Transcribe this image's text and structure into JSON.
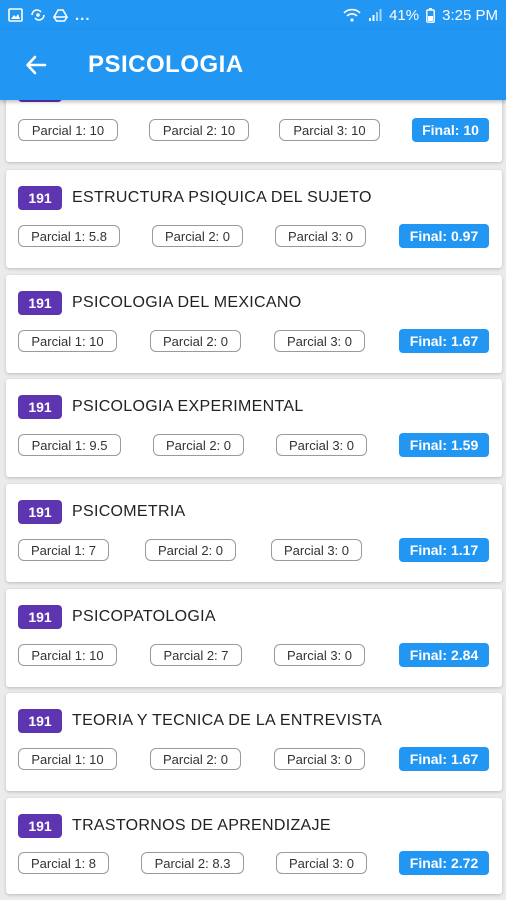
{
  "status_bar": {
    "battery": "41%",
    "time": "3:25 PM",
    "overflow": "..."
  },
  "header": {
    "title": "PSICOLOGIA",
    "back_icon": "arrow-left-icon"
  },
  "colors": {
    "primary": "#2196f3",
    "tag": "#5e35b1"
  },
  "subjects": [
    {
      "code": "",
      "name": "",
      "p1": "Parcial 1: 10",
      "p2": "Parcial 2: 10",
      "p3": "Parcial 3: 10",
      "final": "Final: 10"
    },
    {
      "code": "191",
      "name": "ESTRUCTURA PSIQUICA DEL SUJETO",
      "p1": "Parcial 1: 5.8",
      "p2": "Parcial 2: 0",
      "p3": "Parcial 3: 0",
      "final": "Final: 0.97"
    },
    {
      "code": "191",
      "name": "PSICOLOGIA DEL MEXICANO",
      "p1": "Parcial 1: 10",
      "p2": "Parcial 2: 0",
      "p3": "Parcial 3: 0",
      "final": "Final: 1.67"
    },
    {
      "code": "191",
      "name": "PSICOLOGIA EXPERIMENTAL",
      "p1": "Parcial 1: 9.5",
      "p2": "Parcial 2: 0",
      "p3": "Parcial 3: 0",
      "final": "Final: 1.59"
    },
    {
      "code": "191",
      "name": "PSICOMETRIA",
      "p1": "Parcial 1: 7",
      "p2": "Parcial 2: 0",
      "p3": "Parcial 3: 0",
      "final": "Final: 1.17"
    },
    {
      "code": "191",
      "name": "PSICOPATOLOGIA",
      "p1": "Parcial 1: 10",
      "p2": "Parcial 2: 7",
      "p3": "Parcial 3: 0",
      "final": "Final: 2.84"
    },
    {
      "code": "191",
      "name": "TEORIA Y TECNICA DE LA ENTREVISTA",
      "p1": "Parcial 1: 10",
      "p2": "Parcial 2: 0",
      "p3": "Parcial 3: 0",
      "final": "Final: 1.67"
    },
    {
      "code": "191",
      "name": "TRASTORNOS DE APRENDIZAJE",
      "p1": "Parcial 1: 8",
      "p2": "Parcial 2: 8.3",
      "p3": "Parcial 3: 0",
      "final": "Final: 2.72"
    }
  ]
}
